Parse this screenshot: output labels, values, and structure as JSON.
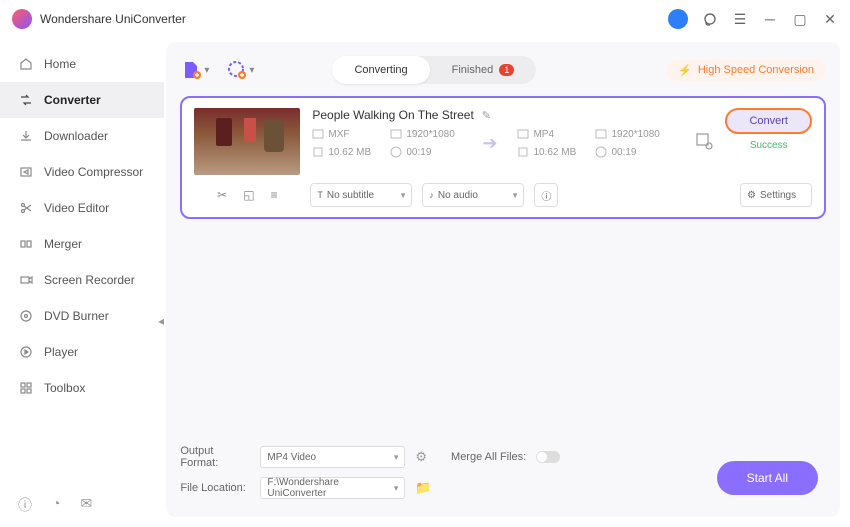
{
  "app": {
    "title": "Wondershare UniConverter"
  },
  "sidebar": {
    "items": [
      {
        "label": "Home"
      },
      {
        "label": "Converter"
      },
      {
        "label": "Downloader"
      },
      {
        "label": "Video Compressor"
      },
      {
        "label": "Video Editor"
      },
      {
        "label": "Merger"
      },
      {
        "label": "Screen Recorder"
      },
      {
        "label": "DVD Burner"
      },
      {
        "label": "Player"
      },
      {
        "label": "Toolbox"
      }
    ],
    "active_index": 1
  },
  "tabs": {
    "converting": "Converting",
    "finished": "Finished",
    "finished_count": "1"
  },
  "hsc": "High Speed Conversion",
  "file": {
    "title": "People Walking On The Street",
    "src": {
      "format": "MXF",
      "resolution": "1920*1080",
      "size": "10.62 MB",
      "duration": "00:19"
    },
    "dst": {
      "format": "MP4",
      "resolution": "1920*1080",
      "size": "10.62 MB",
      "duration": "00:19"
    },
    "subtitle": "No subtitle",
    "audio": "No audio",
    "settings_label": "Settings",
    "convert_label": "Convert",
    "status": "Success"
  },
  "footer": {
    "output_format_label": "Output Format:",
    "output_format_value": "MP4 Video",
    "merge_label": "Merge All Files:",
    "location_label": "File Location:",
    "location_value": "F:\\Wondershare UniConverter",
    "start_all": "Start All"
  }
}
